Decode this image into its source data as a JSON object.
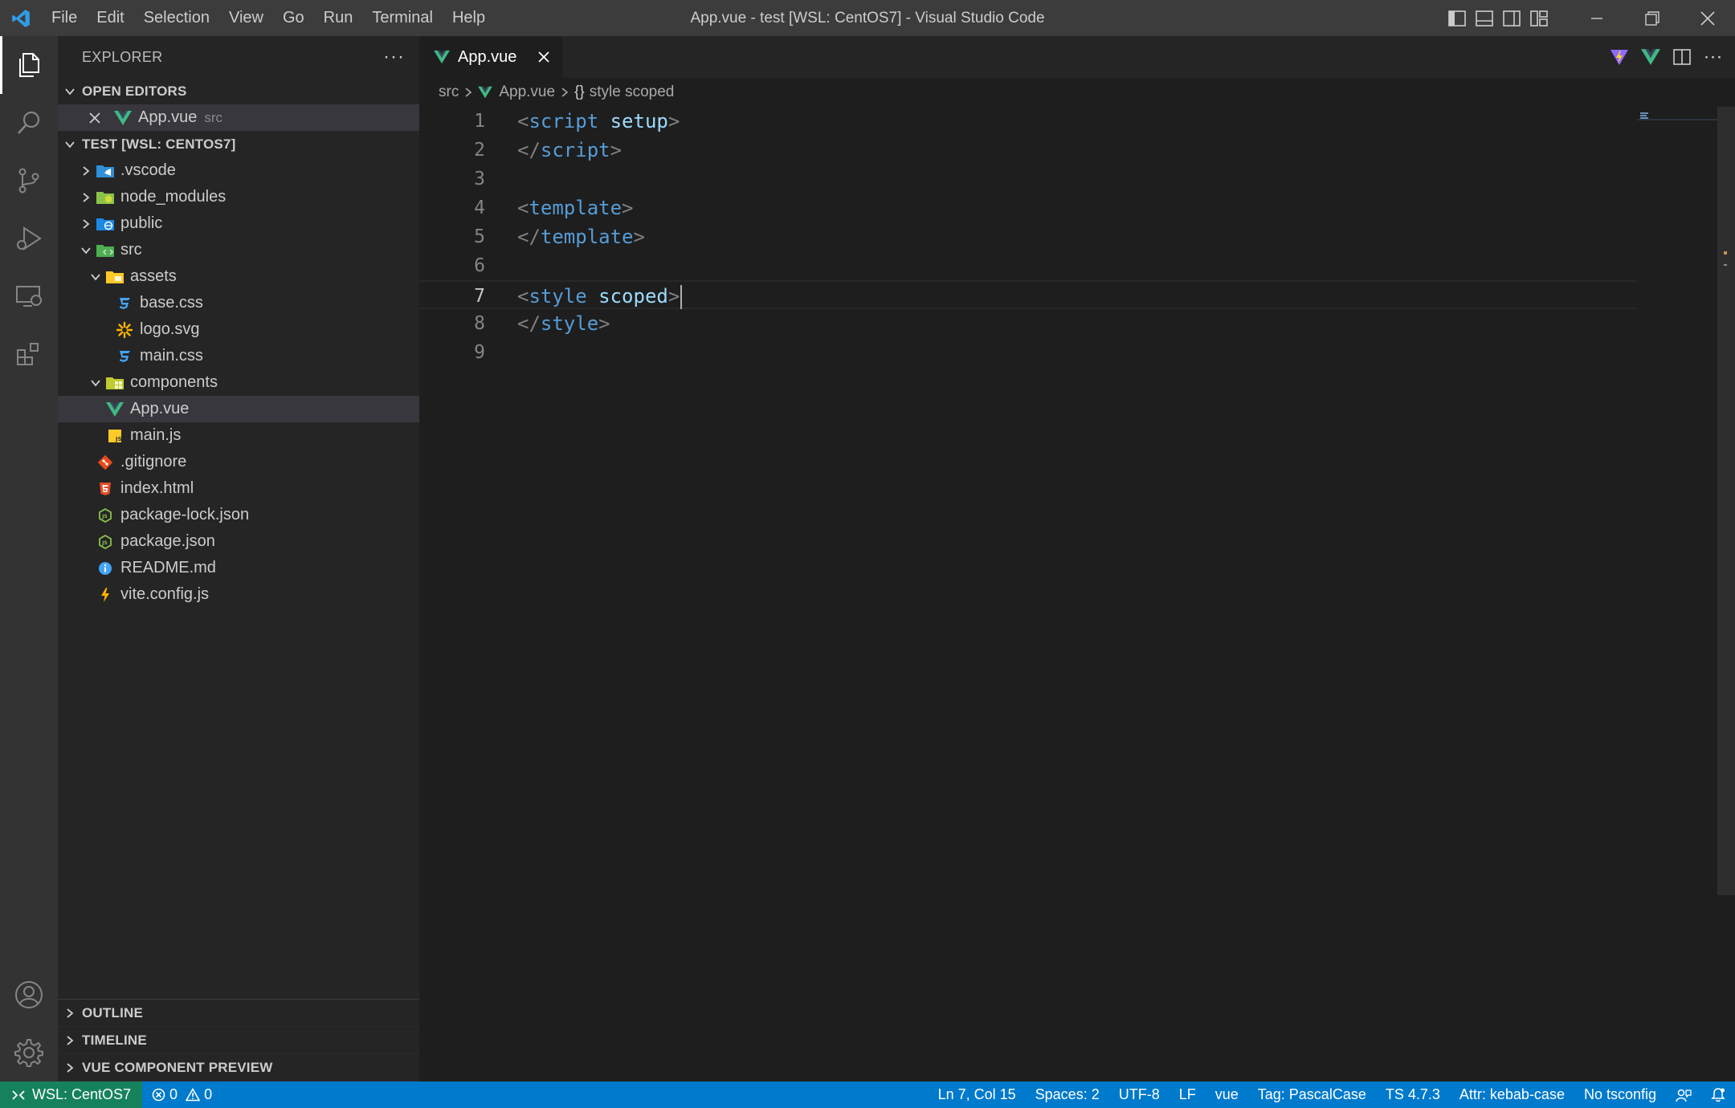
{
  "titlebar": {
    "menu": [
      "File",
      "Edit",
      "Selection",
      "View",
      "Go",
      "Run",
      "Terminal",
      "Help"
    ],
    "title": "App.vue - test [WSL: CentOS7] - Visual Studio Code"
  },
  "sidebar": {
    "header": "EXPLORER",
    "open_editors": {
      "title": "OPEN EDITORS",
      "items": [
        {
          "name": "App.vue",
          "desc": "src"
        }
      ]
    },
    "workspace": {
      "title": "TEST [WSL: CENTOS7]",
      "tree": [
        {
          "name": ".vscode",
          "icon": "vscode-folder-icon"
        },
        {
          "name": "node_modules",
          "icon": "node-folder-icon"
        },
        {
          "name": "public",
          "icon": "public-folder-icon"
        },
        {
          "name": "src",
          "icon": "src-folder-icon"
        },
        {
          "name": "assets",
          "icon": "assets-folder-icon"
        },
        {
          "name": "base.css",
          "icon": "css-file-icon"
        },
        {
          "name": "logo.svg",
          "icon": "svg-file-icon"
        },
        {
          "name": "main.css",
          "icon": "css-file-icon"
        },
        {
          "name": "components",
          "icon": "components-folder-icon"
        },
        {
          "name": "App.vue",
          "icon": "vue-file-icon"
        },
        {
          "name": "main.js",
          "icon": "js-file-icon"
        },
        {
          "name": ".gitignore",
          "icon": "git-file-icon"
        },
        {
          "name": "index.html",
          "icon": "html-file-icon"
        },
        {
          "name": "package-lock.json",
          "icon": "node-file-icon"
        },
        {
          "name": "package.json",
          "icon": "node-file-icon"
        },
        {
          "name": "README.md",
          "icon": "info-file-icon"
        },
        {
          "name": "vite.config.js",
          "icon": "vite-file-icon"
        }
      ]
    },
    "bottom_sections": [
      "OUTLINE",
      "TIMELINE",
      "VUE COMPONENT PREVIEW"
    ]
  },
  "editor": {
    "tab": {
      "label": "App.vue"
    },
    "breadcrumb": {
      "folder": "src",
      "file": "App.vue",
      "symbol_icon": "{}",
      "symbol": "style scoped"
    },
    "lines": [
      {
        "n": "1",
        "open": "<",
        "tag": "script",
        "attr": " setup",
        "close": ">"
      },
      {
        "n": "2",
        "open": "</",
        "tag": "script",
        "attr": "",
        "close": ">"
      },
      {
        "n": "3",
        "open": "",
        "tag": "",
        "attr": "",
        "close": ""
      },
      {
        "n": "4",
        "open": "<",
        "tag": "template",
        "attr": "",
        "close": ">"
      },
      {
        "n": "5",
        "open": "</",
        "tag": "template",
        "attr": "",
        "close": ">"
      },
      {
        "n": "6",
        "open": "",
        "tag": "",
        "attr": "",
        "close": ""
      },
      {
        "n": "7",
        "open": "<",
        "tag": "style",
        "attr": " scoped",
        "close": ">"
      },
      {
        "n": "8",
        "open": "</",
        "tag": "style",
        "attr": "",
        "close": ">"
      },
      {
        "n": "9",
        "open": "",
        "tag": "",
        "attr": "",
        "close": ""
      }
    ],
    "current_line": "7"
  },
  "statusbar": {
    "remote": "WSL: CentOS7",
    "errors": "0",
    "warnings": "0",
    "right_items": [
      "Ln 7, Col 15",
      "Spaces: 2",
      "UTF-8",
      "LF",
      "vue",
      "Tag: PascalCase",
      "TS 4.7.3",
      "Attr: kebab-case",
      "No tsconfig"
    ]
  },
  "colors": {
    "status_bar": "#007acc",
    "remote_indicator": "#16825d",
    "vue_green": "#41b883",
    "tag_blue": "#569cd6",
    "attr_lightblue": "#9cdcfe"
  }
}
